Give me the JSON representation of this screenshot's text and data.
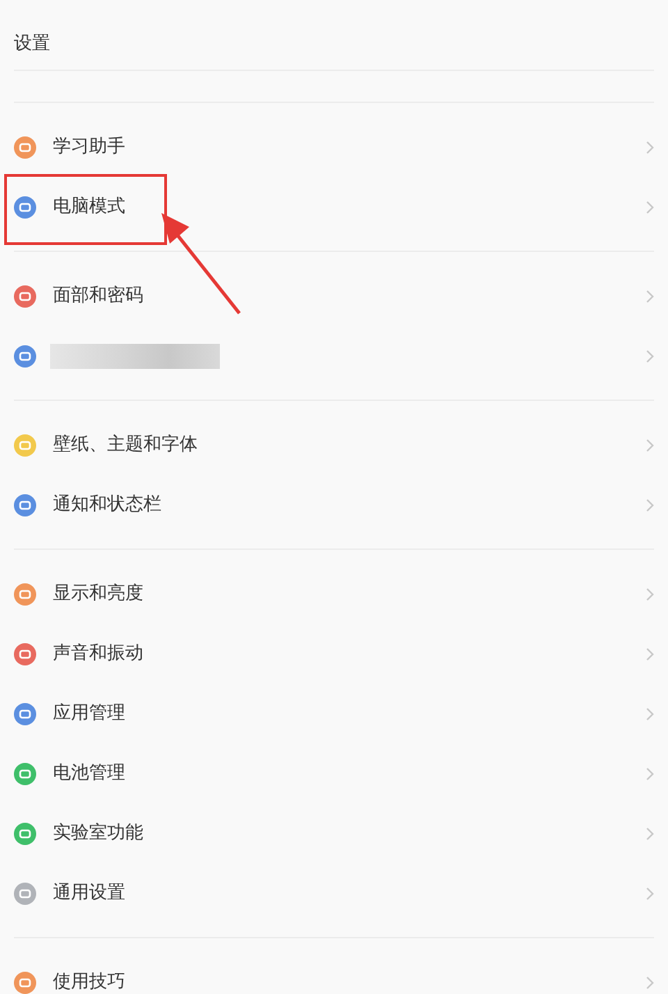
{
  "title": "设置",
  "groups": [
    {
      "items": [
        {
          "kind": "item",
          "label": "学习助手",
          "color": "#f0955a",
          "highlighted": false
        },
        {
          "kind": "item",
          "label": "电脑模式",
          "color": "#5b8fe0",
          "highlighted": true
        }
      ]
    },
    {
      "items": [
        {
          "kind": "item",
          "label": "面部和密码",
          "color": "#e86a5f",
          "highlighted": false
        },
        {
          "kind": "redacted",
          "color": "#5b8fe0",
          "highlighted": false
        }
      ]
    },
    {
      "items": [
        {
          "kind": "item",
          "label": "壁纸、主题和字体",
          "color": "#f2c94c",
          "highlighted": false
        },
        {
          "kind": "item",
          "label": "通知和状态栏",
          "color": "#5b8fe0",
          "highlighted": false
        }
      ]
    },
    {
      "items": [
        {
          "kind": "item",
          "label": "显示和亮度",
          "color": "#f0955a",
          "highlighted": false
        },
        {
          "kind": "item",
          "label": "声音和振动",
          "color": "#e86a5f",
          "highlighted": false
        },
        {
          "kind": "item",
          "label": "应用管理",
          "color": "#5b8fe0",
          "highlighted": false
        },
        {
          "kind": "item",
          "label": "电池管理",
          "color": "#3fbf6a",
          "highlighted": false
        },
        {
          "kind": "item",
          "label": "实验室功能",
          "color": "#3fbf6a",
          "highlighted": false
        },
        {
          "kind": "item",
          "label": "通用设置",
          "color": "#b0b3b8",
          "highlighted": false
        }
      ]
    },
    {
      "items": [
        {
          "kind": "item",
          "label": "使用技巧",
          "color": "#f0955a",
          "highlighted": false
        }
      ]
    }
  ]
}
